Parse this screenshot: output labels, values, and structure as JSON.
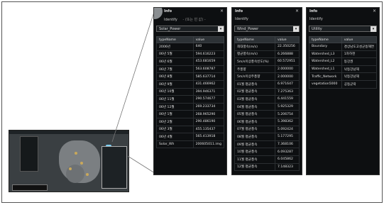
{
  "panels": [
    {
      "title": "Info",
      "close_glyph": "×",
      "identify_label": "Identify",
      "identify_hint": "- (또는 빈 값) -",
      "select_value": "Solar_Power",
      "columns": [
        "typeName",
        "value"
      ],
      "rows": [
        [
          "2006년",
          "640"
        ],
        [
          "06년 5월",
          "594.616223"
        ],
        [
          "06년 6월",
          "453.681659"
        ],
        [
          "06년 7월",
          "563.608787"
        ],
        [
          "06년 8월",
          "585.637714"
        ],
        [
          "06년 9월",
          "431.466962"
        ],
        [
          "06년 10월",
          "394.946371"
        ],
        [
          "06년 11월",
          "290.574677"
        ],
        [
          "06년 12월",
          "269.233734"
        ],
        [
          "06년 1월",
          "268.965290"
        ],
        [
          "06년 2월",
          "290.486190"
        ],
        [
          "06년 3월",
          "455.135437"
        ],
        [
          "06년 4월",
          "565.413918"
        ],
        [
          "Solar_Wh",
          "200605011.img"
        ]
      ]
    },
    {
      "title": "Info",
      "close_glyph": "×",
      "identify_label": "Identify",
      "select_value": "Wind_Power",
      "columns": [
        "typeName",
        "value"
      ],
      "rows": [
        [
          "최대풍속(m/s)",
          "22.350256"
        ],
        [
          "평균풍속(m/s)",
          "6.266888"
        ],
        [
          "5m/s이상풍속빈도(%)",
          "60.572951"
        ],
        [
          "주풍향",
          "2.000000"
        ],
        [
          "5m/s이상주풍향",
          "2.000000"
        ],
        [
          "01월 평균풍속",
          "6.971647"
        ],
        [
          "02월 평균풍속",
          "7.275363"
        ],
        [
          "03월 평균풍속",
          "6.441559"
        ],
        [
          "04월 평균풍속",
          "5.925329"
        ],
        [
          "05월 평균풍속",
          "5.206754"
        ],
        [
          "06월 평균풍속",
          "5.398362"
        ],
        [
          "07월 평균풍속",
          "5.092424"
        ],
        [
          "08월 평균풍속",
          "5.177295"
        ],
        [
          "09월 평균풍속",
          "7.368106"
        ],
        [
          "10월 평균풍속",
          "6.093287"
        ],
        [
          "11월 평균풍속",
          "6.045862"
        ],
        [
          "12월 평균풍속",
          "7.148323"
        ]
      ]
    },
    {
      "title": "Info",
      "close_glyph": "×",
      "identify_label": "Identify",
      "select_value": "Utility",
      "columns": [
        "typeName",
        "value"
      ],
      "rows": [
        [
          "Boundary",
          "경상남도고성군동해면"
        ],
        [
          "Watershed_L3",
          "1차하천"
        ],
        [
          "Watershed_L2",
          "동강권"
        ],
        [
          "Watershed_L1",
          "낙동강남해"
        ],
        [
          "Traffic_Network",
          "낙동강남해"
        ],
        [
          "vegetation5000",
          "공동군락"
        ]
      ]
    }
  ],
  "map": {
    "legend_icon": "map-legend-icon",
    "pin_color": "#7fd3ff",
    "land_color": "#7b7f82",
    "highlight_color": "#c9a85a"
  }
}
